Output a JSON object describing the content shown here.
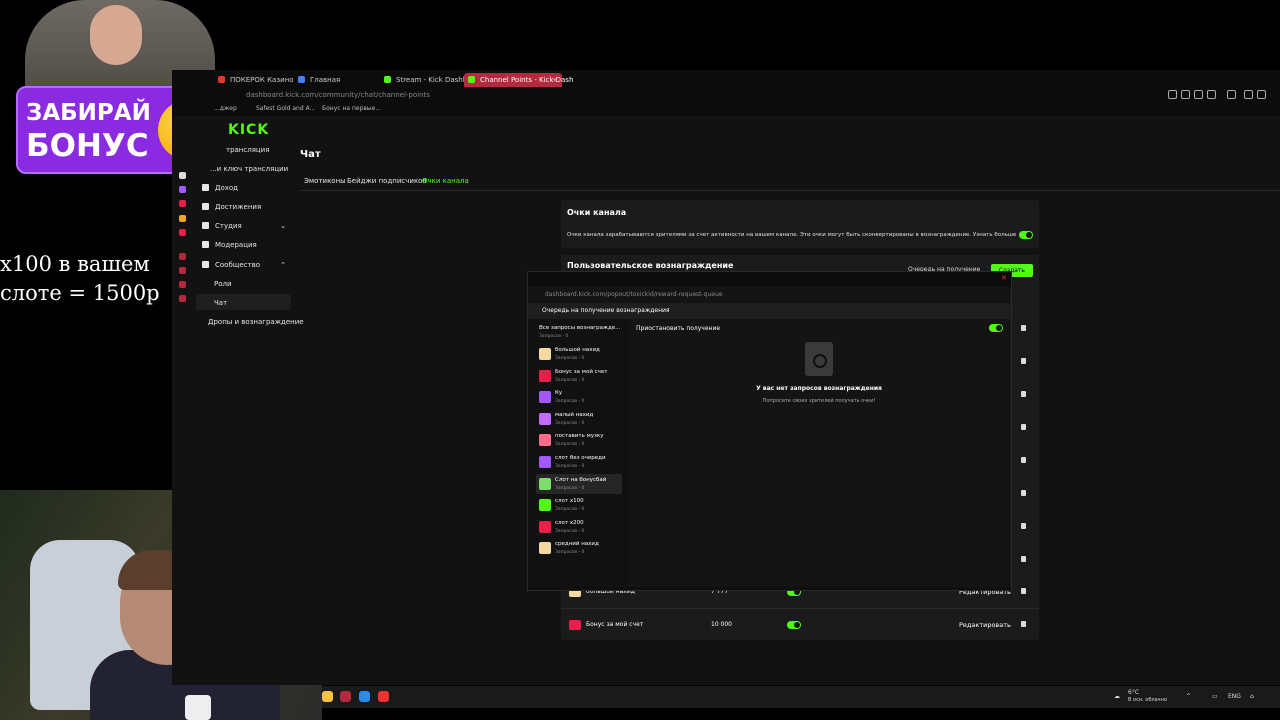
{
  "overlay": {
    "line1": "x100 в вашем",
    "line2": "слоте = 1500р"
  },
  "promo": {
    "line1": "ЗАБИРАЙ",
    "line2": "БОНУС"
  },
  "browser": {
    "tabs": [
      {
        "label": "ПОКЕРОК Казино",
        "color": "#e33"
      },
      {
        "label": "Главная",
        "color": "#4a7dff"
      },
      {
        "label": "Stream - Kick Dashboard",
        "color": "#53fc18"
      },
      {
        "label": "Channel Points - Kick Dash",
        "color": "#53fc18"
      }
    ],
    "new_tab": "+",
    "url": "dashboard.kick.com/community/chat/channel-points",
    "bookmarks": [
      "...джер",
      "Safest Gold and A...",
      "Бонус на первые..."
    ]
  },
  "sidebar": {
    "logo": "KICK",
    "items": [
      "трансляция",
      "...и ключ трансляции",
      "Доход",
      "Достижения",
      "Студия",
      "Модерация",
      "Сообщество",
      "Роли",
      "Чат",
      "Дропы и вознаграждение"
    ]
  },
  "page": {
    "title": "Чат",
    "tabs": [
      "Эмотиконы",
      "Бейджи подписчиков",
      "Очки канала"
    ],
    "points_card": {
      "title": "Очки канала",
      "desc": "Очки канала зарабатываются зрителями за счет активности на вашем канале. Эти очки могут быть сконвертированы в вознаграждение. Узнать больше"
    },
    "reward_card": {
      "title": "Пользовательское вознаграждение",
      "queue_label": "Очередь на получение",
      "create": "Создать"
    },
    "rewards": [
      {
        "name": "большой нахид",
        "cost": "7 777",
        "edit": "Редактировать",
        "color": "#f5d9a0"
      },
      {
        "name": "Бонус за мой счет",
        "cost": "10 000",
        "edit": "Редактировать",
        "color": "#e8204a"
      }
    ]
  },
  "popup": {
    "url": "dashboard.kick.com/popout/toxickid/reward-request-queue",
    "header": "Очередь на получение вознаграждения",
    "all": {
      "label": "Все запросы вознагражде...",
      "count": "Запросов - 0"
    },
    "items": [
      {
        "name": "большой нахид",
        "count": "Запросов - 0",
        "color": "#f5d9a0"
      },
      {
        "name": "Бонус за мой счет",
        "count": "Запросов - 0",
        "color": "#e8204a"
      },
      {
        "name": "Ку",
        "count": "Запросов - 0",
        "color": "#a259ff"
      },
      {
        "name": "малый нахид",
        "count": "Запросов - 0",
        "color": "#c36bff"
      },
      {
        "name": "поставить музку",
        "count": "Запросов - 0",
        "color": "#ff6b8a"
      },
      {
        "name": "слот без очереди",
        "count": "Запросов - 0",
        "color": "#a259ff"
      },
      {
        "name": "Слот на бонусбай",
        "count": "Запросов - 0",
        "color": "#7ddc6a"
      },
      {
        "name": "слот x100",
        "count": "Запросов - 0",
        "color": "#53fc18"
      },
      {
        "name": "слот x200",
        "count": "Запросов - 0",
        "color": "#e8204a"
      },
      {
        "name": "средний нахид",
        "count": "Запросов - 0",
        "color": "#f5d9a0"
      }
    ],
    "pause_label": "Приостановить получение",
    "empty_title": "У вас нет запросов вознаграждения",
    "empty_sub": "Попросите своих зрителей получать очки!"
  },
  "taskbar": {
    "weather": "6°C",
    "weather_sub": "В осн. облачно",
    "lang": "ENG"
  },
  "colors": {
    "accent": "#53fc18",
    "active_tab": "#b22a3c"
  }
}
